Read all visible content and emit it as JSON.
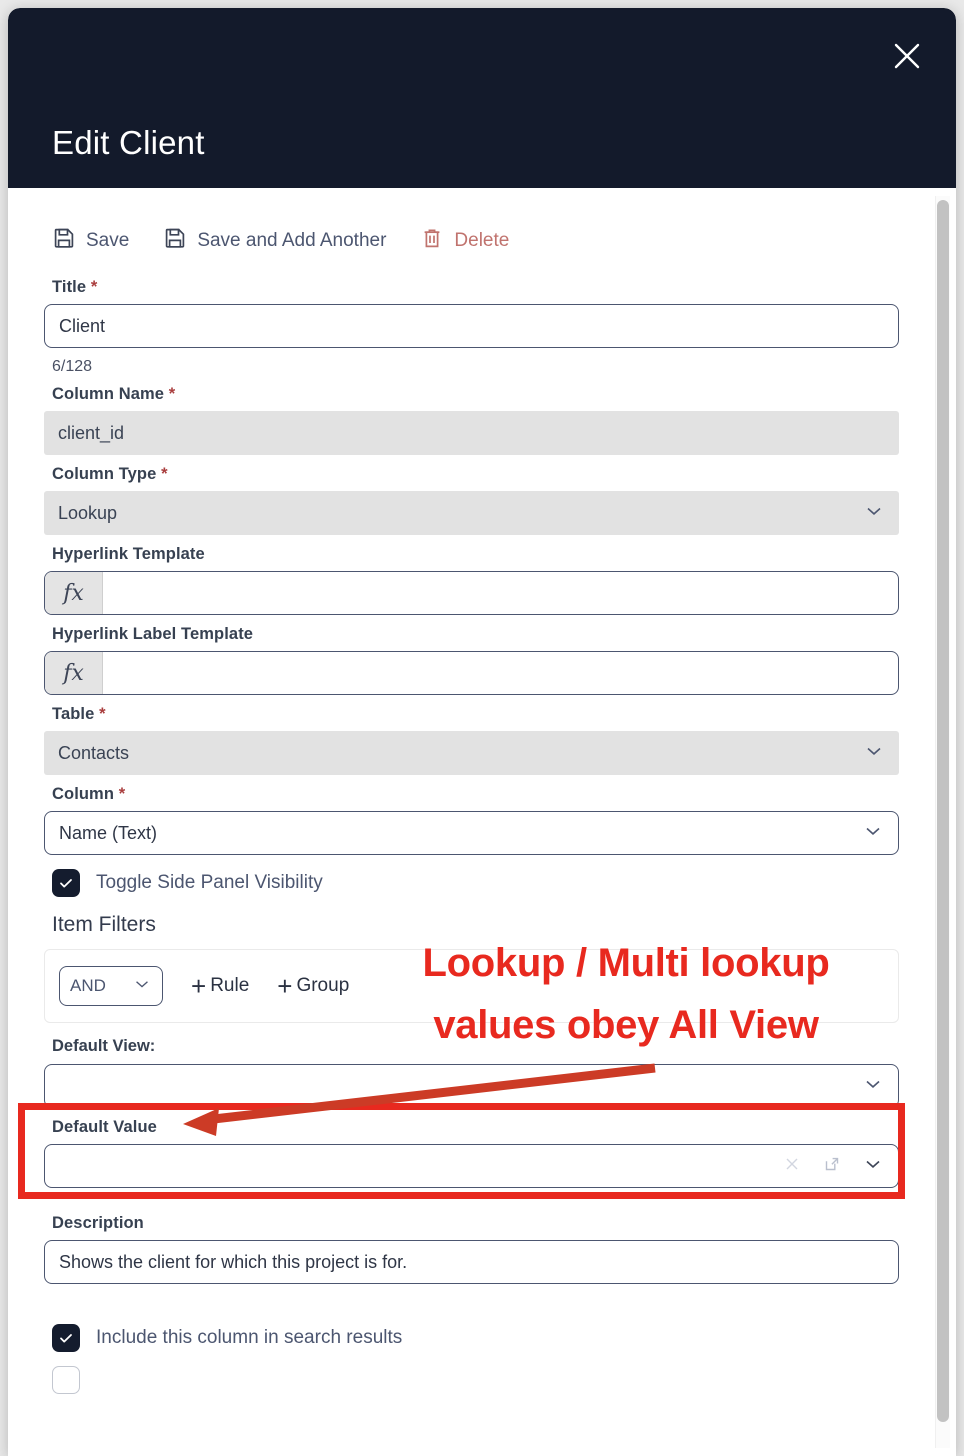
{
  "window": {
    "title": "Edit Client",
    "close_icon": "close-icon"
  },
  "toolbar": {
    "items": [
      {
        "label": "Save",
        "icon": "floppy-disk-icon",
        "style": "normal"
      },
      {
        "label": "Save and Add Another",
        "icon": "floppy-disk-icon",
        "style": "normal"
      },
      {
        "label": "Delete",
        "icon": "trash-icon",
        "style": "danger"
      }
    ]
  },
  "form": {
    "title": {
      "label": "Title",
      "required": "*",
      "value": "Client",
      "counter": "6/128"
    },
    "column_name": {
      "label": "Column Name",
      "required": "*",
      "value": "client_id"
    },
    "column_type": {
      "label": "Column Type",
      "required": "*",
      "value": "Lookup"
    },
    "hyperlink_template": {
      "label": "Hyperlink Template",
      "prefix": "fx",
      "value": ""
    },
    "hyperlink_label_template": {
      "label": "Hyperlink Label Template",
      "prefix": "fx",
      "value": ""
    },
    "table": {
      "label": "Table",
      "required": "*",
      "value": "Contacts"
    },
    "column": {
      "label": "Column",
      "required": "*",
      "value": "Name (Text)"
    },
    "toggle_side_panel": {
      "label": "Toggle Side Panel Visibility",
      "checked": true
    },
    "item_filters": {
      "title": "Item Filters",
      "operator": "AND",
      "add_rule": "Rule",
      "add_group": "Group",
      "plus": "+"
    },
    "default_view": {
      "label": "Default View:",
      "value": ""
    },
    "default_value": {
      "label": "Default Value",
      "value": "",
      "icons": [
        "clear-icon",
        "open-external-icon",
        "chevron-down-icon"
      ]
    },
    "description": {
      "label": "Description",
      "value": "Shows the client for which this project is for."
    },
    "include_in_search": {
      "label": "Include this column in search results",
      "checked": true
    },
    "clipped_checkbox": {
      "label": "",
      "checked": false
    }
  },
  "annotations": {
    "callout_line1": "Lookup / Multi lookup",
    "callout_line2": "values obey All View",
    "color": "#e8291f"
  },
  "colors": {
    "header_bg": "#131a2b",
    "accent_danger": "#c0736e",
    "annotation_red": "#e8291f",
    "field_border": "#4c5670",
    "disabled_bg": "#e2e2e2",
    "checkbox_on": "#141c2e"
  }
}
